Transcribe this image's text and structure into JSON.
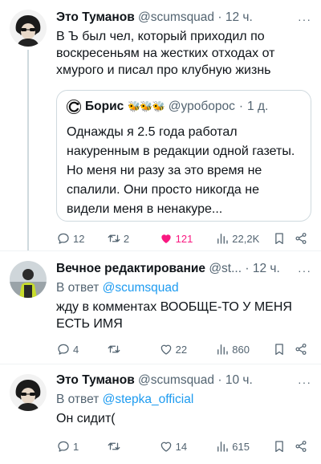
{
  "tweets": [
    {
      "name": "Это Туманов",
      "handle": "@scumsquad",
      "sep": "·",
      "time": "12 ч.",
      "more": "···",
      "text": "В Ъ был чел, который приходил по воскресеньям на жестких отходах от хмурого и писал про клубную жизнь",
      "quote": {
        "name": "Борис",
        "badges": "🐝🐝🐝",
        "handle": "@уроборос",
        "sep": "·",
        "time": "1 д.",
        "text": "Однажды я 2.5 года работал накуренным в редакции одной газеты. Но меня ни разу за это время не спалили. Они просто никогда не видели меня в ненакуре..."
      },
      "actions": {
        "replies": "12",
        "retweets": "2",
        "likes": "121",
        "views": "22,2K"
      }
    },
    {
      "name": "Вечное редактирование",
      "handle": "@st...",
      "sep": "·",
      "time": "12 ч.",
      "more": "···",
      "reply_prefix": "В ответ",
      "reply_to": "@scumsquad",
      "text": "жду в комментах ВООБЩЕ-ТО У МЕНЯ ЕСТЬ ИМЯ",
      "actions": {
        "replies": "4",
        "retweets": "",
        "likes": "22",
        "views": "860"
      }
    },
    {
      "name": "Это Туманов",
      "handle": "@scumsquad",
      "sep": "·",
      "time": "10 ч.",
      "more": "···",
      "reply_prefix": "В ответ",
      "reply_to": "@stepka_official",
      "text": "Он сидит(",
      "actions": {
        "replies": "1",
        "retweets": "",
        "likes": "14",
        "views": "615"
      }
    }
  ],
  "colors": {
    "accent": "#1d9bf0",
    "like": "#f91880",
    "muted": "#536471"
  },
  "icons": [
    "reply-icon",
    "retweet-icon",
    "heart-icon",
    "views-icon",
    "bookmark-icon",
    "share-icon"
  ]
}
